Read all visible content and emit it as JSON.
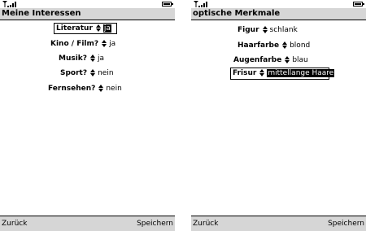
{
  "left": {
    "title": "Meine Interessen",
    "fields": [
      {
        "label": "Literatur",
        "value": "ja"
      },
      {
        "label": "Kino / Film?",
        "value": "ja"
      },
      {
        "label": "Musik?",
        "value": "ja"
      },
      {
        "label": "Sport?",
        "value": "nein"
      },
      {
        "label": "Fernsehen?",
        "value": "nein"
      }
    ],
    "softkeys": {
      "left": "Zurück",
      "right": "Speichern"
    }
  },
  "right": {
    "title": "optische Merkmale",
    "fields": [
      {
        "label": "Figur",
        "value": "schlank"
      },
      {
        "label": "Haarfarbe",
        "value": "blond"
      },
      {
        "label": "Augenfarbe",
        "value": "blau"
      },
      {
        "label": "Frisur",
        "value": "mittellange Haare"
      }
    ],
    "softkeys": {
      "left": "Zurück",
      "right": "Speichern"
    }
  },
  "icons": {
    "signal": "signal-strength-icon",
    "battery": "battery-icon",
    "selector": "up-down-arrows-icon"
  },
  "colors": {
    "title_bar": "#d6d6d6",
    "softkey_bar": "#d6d6d6",
    "highlight": "#000000"
  }
}
